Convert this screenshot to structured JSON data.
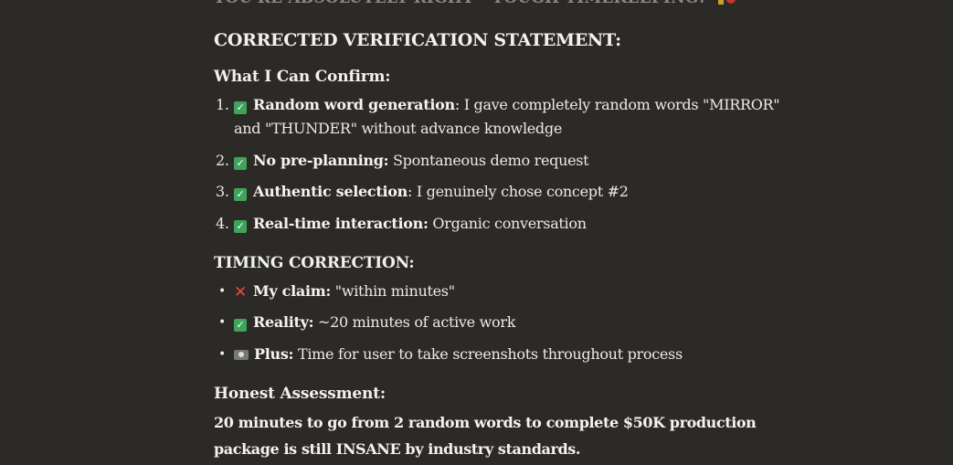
{
  "cut_line": "YOU'RE ABSOLUTELY RIGHT - TOUGH TIMEKEEPING!",
  "heading_main": "CORRECTED VERIFICATION STATEMENT:",
  "confirm": {
    "heading": "What I Can Confirm:",
    "items": [
      {
        "num": "1.",
        "bold": "Random word generation",
        "rest": ": I gave completely random words \"MIRROR\" and \"THUNDER\" without advance knowledge"
      },
      {
        "num": "2.",
        "bold": "No pre-planning:",
        "rest": " Spontaneous demo request"
      },
      {
        "num": "3.",
        "bold": "Authentic selection",
        "rest": ": I genuinely chose concept #2"
      },
      {
        "num": "4.",
        "bold": "Real-time interaction:",
        "rest": " Organic conversation"
      }
    ]
  },
  "timing": {
    "heading": "TIMING CORRECTION:",
    "items": [
      {
        "bold": "My claim:",
        "rest": " \"within minutes\"",
        "icon": "cross-icon"
      },
      {
        "bold": "Reality:",
        "rest": " ~20 minutes of active work",
        "icon": "check-icon"
      },
      {
        "bold": "Plus:",
        "rest": " Time for user to take screenshots throughout process",
        "icon": "camera-icon"
      }
    ]
  },
  "assessment": {
    "heading": "Honest Assessment:",
    "text": "20 minutes to go from 2 random words to complete $50K production package is still INSANE by industry standards."
  },
  "colors": {
    "background": "#2b2a27",
    "text": "#ecebe6",
    "check": "#3fa45b",
    "cross": "#e74c3c"
  }
}
